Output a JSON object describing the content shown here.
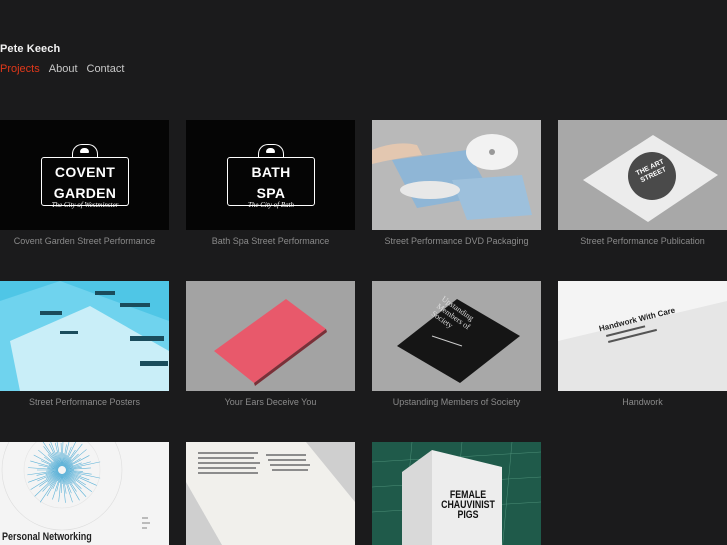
{
  "header": {
    "site_title": "Pete Keech",
    "nav": [
      {
        "label": "Projects",
        "active": true
      },
      {
        "label": "About",
        "active": false
      },
      {
        "label": "Contact",
        "active": false
      }
    ]
  },
  "colors": {
    "background": "#1b1b1c",
    "accent": "#e0381a",
    "caption": "#8a8a8a"
  },
  "projects": [
    {
      "caption": "Covent Garden Street Performance",
      "thumb_line1": "COVENT",
      "thumb_line2": "GARDEN",
      "thumb_sub": "The City of Westminster"
    },
    {
      "caption": "Bath Spa Street Performance",
      "thumb_line1": "BATH",
      "thumb_line2": "SPA",
      "thumb_sub": "The City of Bath"
    },
    {
      "caption": "Street Performance DVD Packaging"
    },
    {
      "caption": "Street Performance Publication",
      "thumb_text": "THE ART STREET"
    },
    {
      "caption": "Street Performance Posters"
    },
    {
      "caption": "Your Ears Deceive You"
    },
    {
      "caption": "Upstanding Members of Society",
      "thumb_text": "Upstanding Members of Society"
    },
    {
      "caption": "Handwork",
      "thumb_text": "Handwork With Care"
    },
    {
      "thumb_text": "Personal Networking"
    },
    {},
    {
      "thumb_text_line1": "FEMALE",
      "thumb_text_line2": "CHAUVINIST",
      "thumb_text_line3": "PIGS"
    }
  ]
}
